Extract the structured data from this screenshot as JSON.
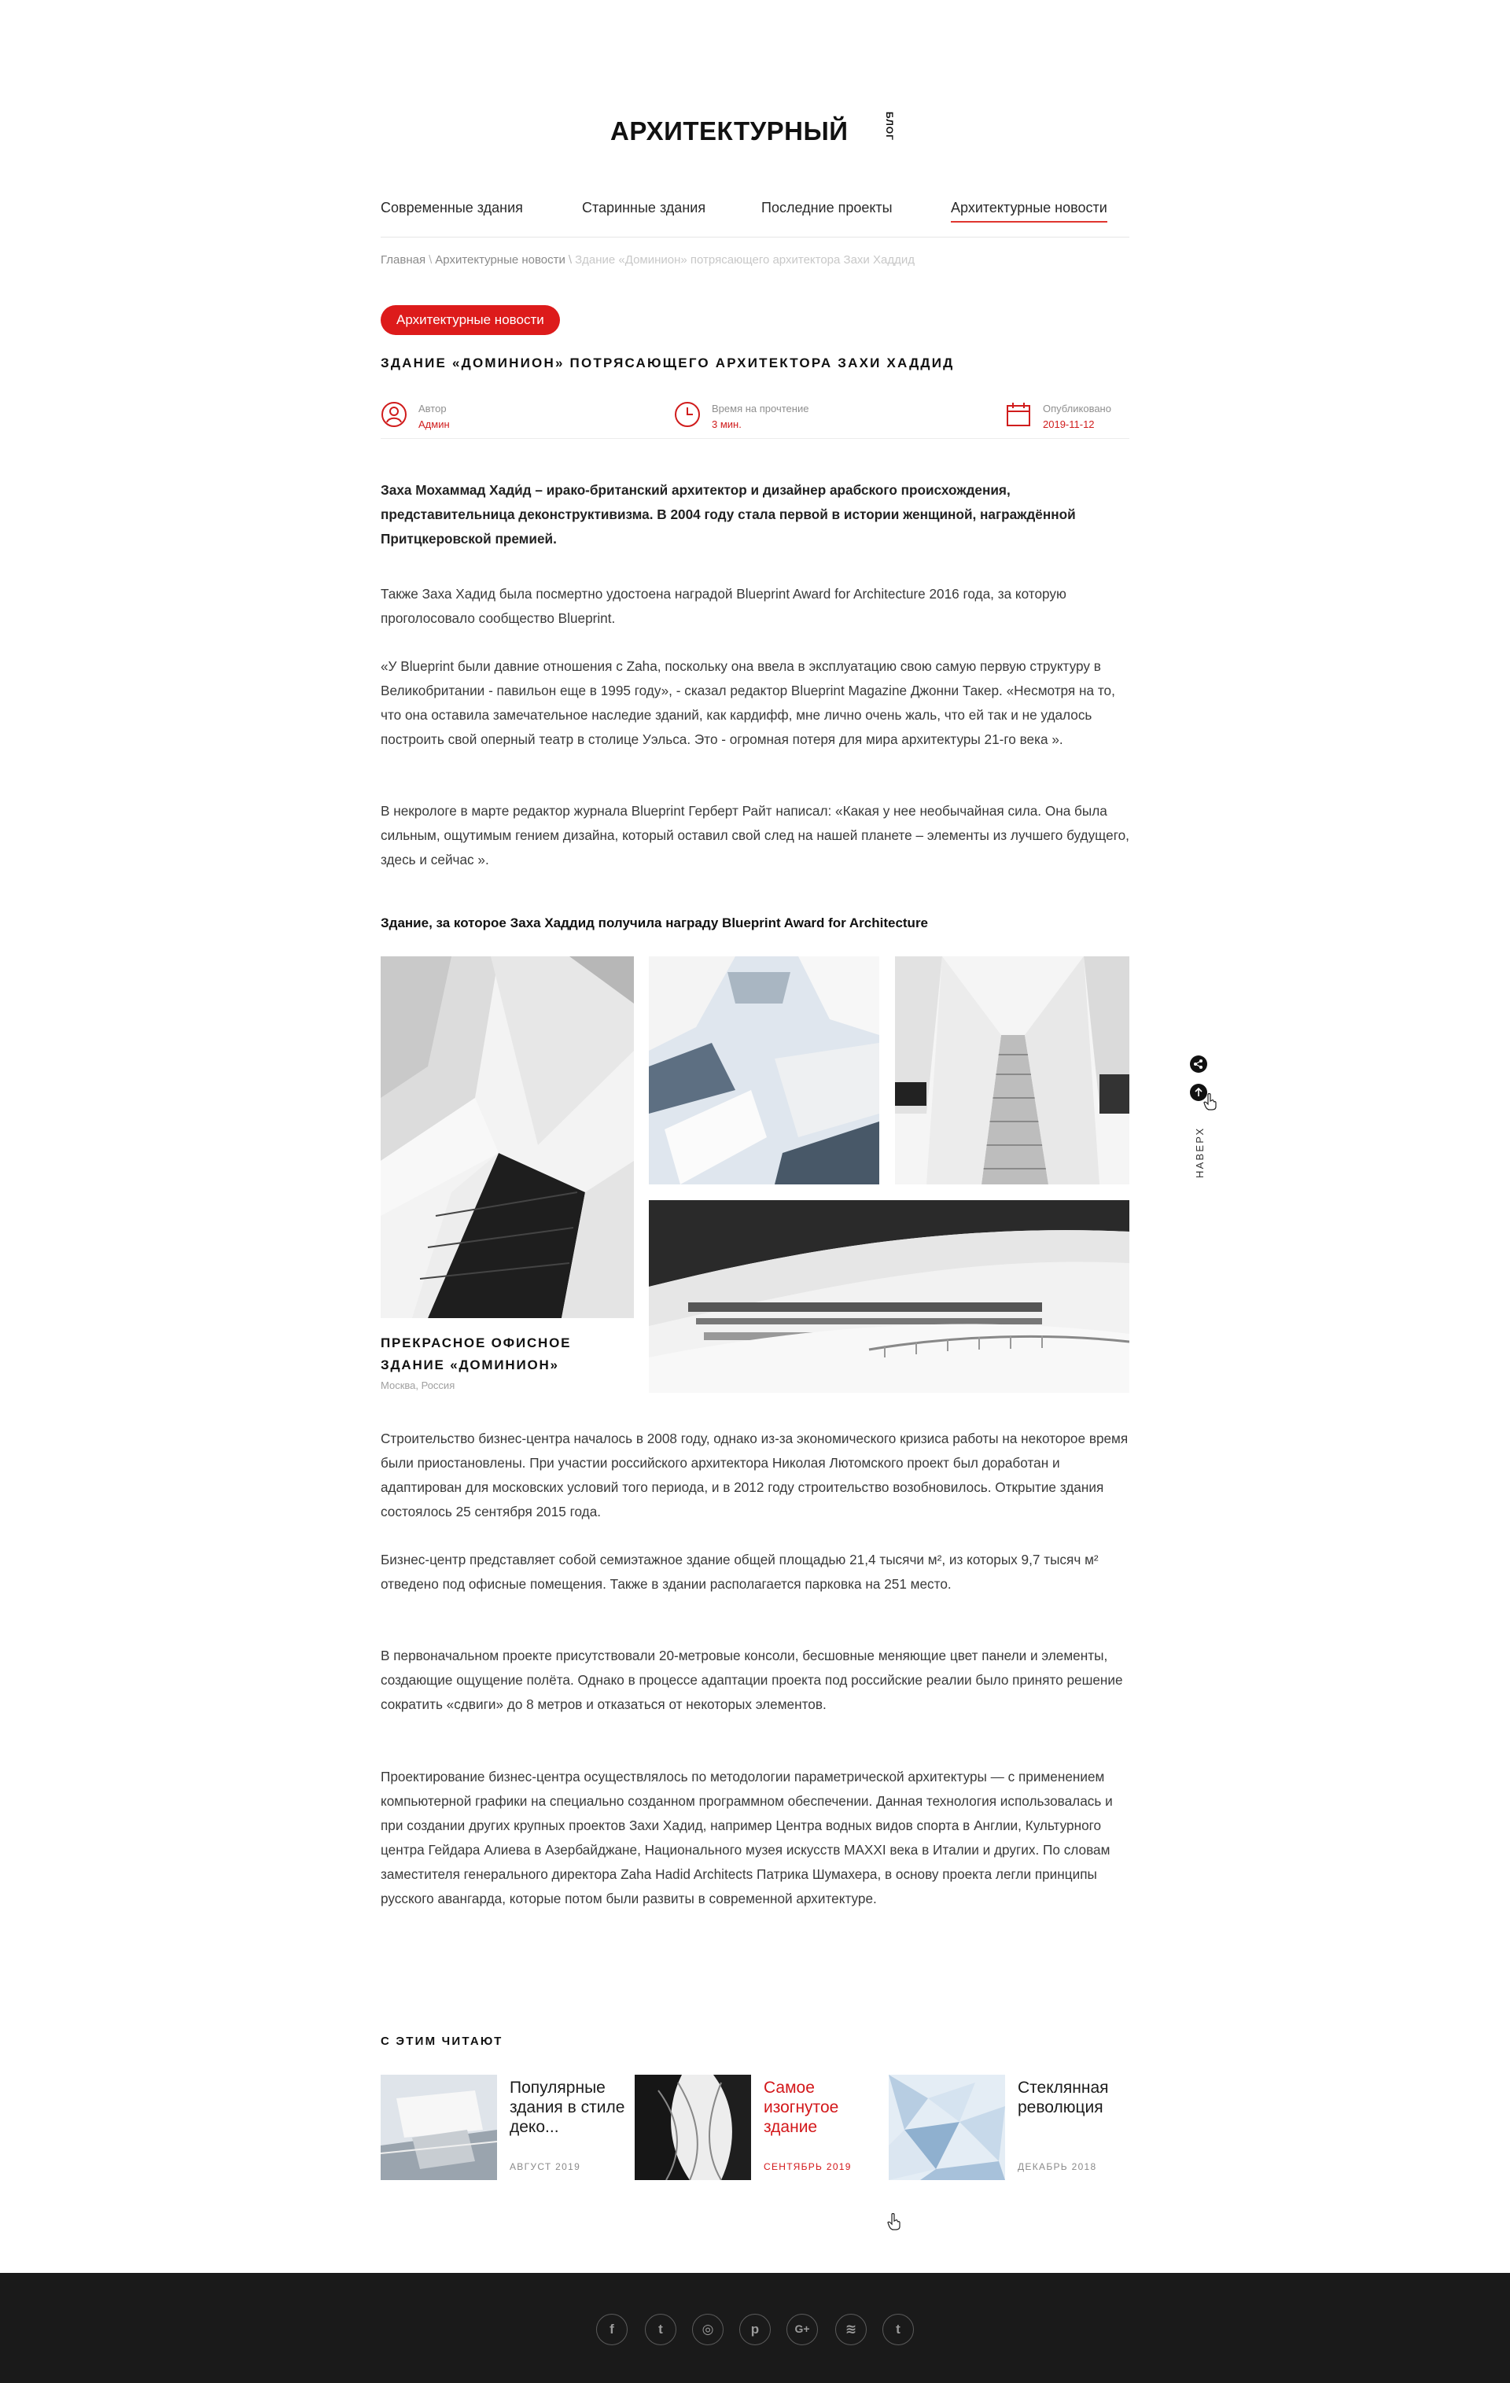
{
  "logo": {
    "main": "АРХИТЕКТУРНЫЙ",
    "sub": "БЛОГ"
  },
  "nav": [
    {
      "label": "Современные здания",
      "active": false
    },
    {
      "label": "Старинные здания",
      "active": false
    },
    {
      "label": "Последние проекты",
      "active": false
    },
    {
      "label": "Архитектурные новости",
      "active": true
    }
  ],
  "breadcrumb": {
    "items": [
      "Главная",
      "Архитектурные новости"
    ],
    "separator": "\\",
    "current": "Здание «Доминион» потрясающего архитектора Захи Хаддид"
  },
  "article": {
    "category": "Архитектурные новости",
    "title": "ЗДАНИЕ «ДОМИНИОН» ПОТРЯСАЮЩЕГО АРХИТЕКТОРА ЗАХИ ХАДДИД",
    "meta": {
      "author_label": "Автор",
      "author": "Админ",
      "read_label": "Время на прочтение",
      "read_time": "3 мин.",
      "published_label": "Опубликовано",
      "published": "2019-11-12"
    },
    "lead": "Заха Мохаммад Хади́д – ирако-британский архитектор и дизайнер арабского происхождения, представительница деконструктивизма. В 2004 году стала первой в истории женщиной, награждённой Притцкеровской премией.",
    "paragraphs_1": [
      "Также Заха Хадид была посмертно удостоена наградой Blueprint Award for Architecture 2016 года, за которую проголосовало сообщество Blueprint.",
      "«У Blueprint были давние отношения с Zaha, поскольку она ввела в эксплуатацию свою самую первую структуру в Великобритании - павильон еще в 1995 году», - сказал редактор Blueprint Magazine Джонни Такер. «Несмотря на то, что она оставила замечательное наследие зданий, как кардифф, мне лично очень жаль, что ей так и не удалось построить свой оперный театр в столице Уэльса. Это - огромная потеря для мира архитектуры 21-го века ».",
      "В некрологе в марте редактор журнала Blueprint Герберт Райт написал: «Какая у нее необычайная сила. Она была сильным, ощутимым гением дизайна, который оставил свой след на нашей планете – элементы из лучшего будущего, здесь и сейчас »."
    ],
    "gallery_heading": "Здание, за которое Заха Хаддид получила награду Blueprint Award for Architecture",
    "gallery_caption": "ПРЕКРАСНОЕ ОФИСНОЕ ЗДАНИЕ «ДОМИНИОН»",
    "gallery_location": "Москва, Россия",
    "paragraphs_2": [
      "Строительство бизнес-центра началось в 2008 году, однако из-за экономического кризиса работы на некоторое время были приостановлены. При участии российского архитектора Николая Лютомского проект был доработан и адаптирован для московских условий того периода, и в 2012 году строительство возобновилось. Открытие здания состоялось 25 сентября 2015 года.",
      "Бизнес-центр представляет собой семиэтажное здание общей площадью 21,4 тысячи м², из которых 9,7 тысяч м² отведено под офисные помещения. Также в здании располагается парковка на 251 место.",
      "В первоначальном проекте присутствовали 20-метровые консоли, бесшовные меняющие цвет панели и элементы, создающие ощущение полёта. Однако в процессе адаптации проекта под российские реалии было принято решение сократить «сдвиги» до 8 метров и отказаться от некоторых элементов.",
      "Проектирование бизнес-центра осуществлялось по методологии параметрической архитектуры — с применением компьютерной графики на специально созданном программном обеспечении. Данная технология использовалась и при создании других крупных проектов Захи Хадид, например Центра водных видов спорта в Англии, Культурного центра Гейдара Алиева в Азербайджане, Национального музея искусств MAXXI века в Италии и других. По словам заместителя генерального директора Zaha Hadid Architects Патрика Шумахера, в основу проекта легли принципы русского авангарда, которые потом были развиты в современной архитектуре."
    ]
  },
  "side": {
    "top_label": "НАВЕРХ",
    "share_icon": "share-icon",
    "up_icon": "arrow-up-icon"
  },
  "related": {
    "heading": "С ЭТИМ ЧИТАЮТ",
    "items": [
      {
        "title": "Популярные здания в стиле деко...",
        "date": "АВГУСТ 2019",
        "highlight": false
      },
      {
        "title": "Самое изогнутое здание",
        "date": "СЕНТЯБРЬ 2019",
        "highlight": true
      },
      {
        "title": "Стеклянная революция",
        "date": "ДЕКАБРЬ 2018",
        "highlight": false
      }
    ]
  },
  "footer": {
    "social": [
      {
        "icon": "facebook-icon",
        "glyph": "f"
      },
      {
        "icon": "twitter-icon",
        "glyph": "t"
      },
      {
        "icon": "instagram-icon",
        "glyph": "◎"
      },
      {
        "icon": "pinterest-icon",
        "glyph": "p"
      },
      {
        "icon": "google-plus-icon",
        "glyph": "G+"
      },
      {
        "icon": "spotify-icon",
        "glyph": "≋"
      },
      {
        "icon": "tumblr-icon",
        "glyph": "t"
      }
    ]
  },
  "colors": {
    "accent": "#dd1b1b",
    "footer_bg": "#1a1a1a",
    "text": "#3a3a3a"
  }
}
